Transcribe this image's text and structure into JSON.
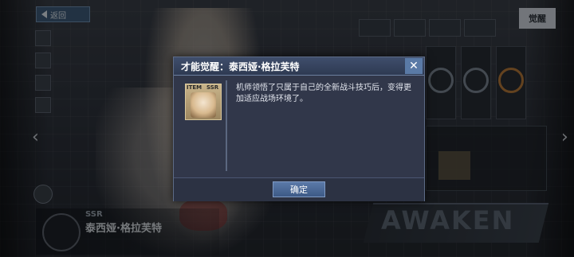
{
  "dialog": {
    "title": "才能觉醒：泰西娅·格拉芙特",
    "close_icon": "close-icon",
    "item": {
      "tag": "ITEM",
      "rarity": "SSR"
    },
    "description": "机师领悟了只属于自己的全新战斗技巧后，变得更加适应战场环境了。",
    "confirm_label": "确定"
  },
  "background": {
    "back_label": "返回",
    "awaken_tab": "觉醒",
    "awaken_banner": "AWAKEN",
    "nameplate": {
      "rarity": "SSR",
      "name": "泰西娅·格拉芙特"
    }
  },
  "colors": {
    "dialog_bg": "#343a4e",
    "header_bg": "#3f4e6c",
    "confirm_btn": "#4a6a9a",
    "close_btn": "#5a7aa6"
  }
}
